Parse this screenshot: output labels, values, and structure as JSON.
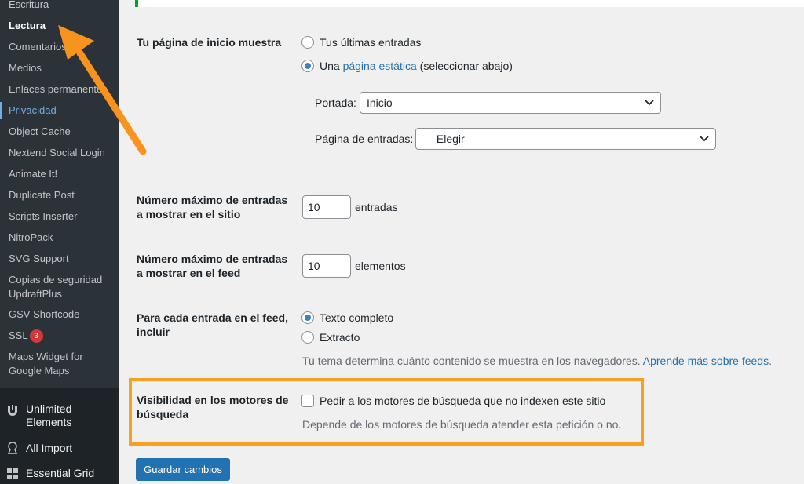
{
  "sidebar": {
    "submenu": {
      "escritura": "Escritura",
      "lectura": "Lectura",
      "comentarios": "Comentarios",
      "medios": "Medios",
      "enlaces": "Enlaces permanentes",
      "privacidad": "Privacidad",
      "object_cache": "Object Cache",
      "nextend": "Nextend Social Login",
      "animate": "Animate It!",
      "duplicate": "Duplicate Post",
      "scripts": "Scripts Inserter",
      "nitropack": "NitroPack",
      "svg": "SVG Support",
      "updraft_1": "Copias de seguridad",
      "updraft_2": "UpdraftPlus",
      "gsv": "GSV Shortcode",
      "ssl": "SSL",
      "ssl_badge": "3",
      "maps_1": "Maps Widget for",
      "maps_2": "Google Maps"
    },
    "main": {
      "unlimited_1": "Unlimited",
      "unlimited_2": "Elements",
      "all_import": "All Import",
      "essential_grid": "Essential Grid"
    }
  },
  "front_page": {
    "label": "Tu página de inicio muestra",
    "option_latest": "Tus últimas entradas",
    "option_static_prefix": "Una",
    "option_static_link": "página estática",
    "option_static_suffix": "(seleccionar abajo)",
    "portada_label": "Portada:",
    "portada_value": "Inicio",
    "posts_page_label": "Página de entradas:",
    "posts_page_value": "— Elegir —"
  },
  "posts_per_page": {
    "label_1": "Número máximo de entradas",
    "label_2": "a mostrar en el sitio",
    "value": "10",
    "unit": "entradas"
  },
  "feed_items": {
    "label_1": "Número máximo de entradas",
    "label_2": "a mostrar en el feed",
    "value": "10",
    "unit": "elementos"
  },
  "feed_content": {
    "label_1": "Para cada entrada en el feed,",
    "label_2": "incluir",
    "option_full": "Texto completo",
    "option_excerpt": "Extracto",
    "description": "Tu tema determina cuánto contenido se muestra en los navegadores.",
    "description_link": "Aprende más sobre feeds",
    "description_end": "."
  },
  "visibility": {
    "label_1": "Visibilidad en los motores de",
    "label_2": "búsqueda",
    "checkbox_label": "Pedir a los motores de búsqueda que no indexen este sitio",
    "description": "Depende de los motores de búsqueda atender esta petición o no."
  },
  "save_button": "Guardar cambios",
  "colors": {
    "accent": "#2271b1",
    "highlight": "#f7a024",
    "arrow": "#f7931e",
    "sidebar_bg": "#1d2327",
    "submenu_bg": "#2c3338"
  }
}
